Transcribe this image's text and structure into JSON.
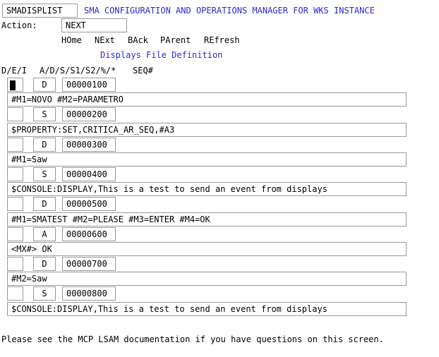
{
  "header": {
    "screen_name": "SMADISPLIST",
    "title": "SMA CONFIGURATION AND OPERATIONS MANAGER FOR WKS INSTANCE"
  },
  "action": {
    "label": "Action:",
    "value": "NEXT"
  },
  "nav": {
    "home": "HOme",
    "next": "NExt",
    "back": "BAck",
    "parent": "PArent",
    "refresh": "REfresh"
  },
  "subtitle": "Displays File Definition",
  "columns": {
    "dei": "D/E/I",
    "type": "A/D/S/S1/S2/%/*",
    "seq": "SEQ#"
  },
  "rows": [
    {
      "dei": "",
      "type": "D",
      "seq": "00000100",
      "text": "#M1=NOVO #M2=PARAMETRO"
    },
    {
      "dei": "",
      "type": "S",
      "seq": "00000200",
      "text": "$PROPERTY:SET,CRITICA_AR_SEQ,#A3"
    },
    {
      "dei": "",
      "type": "D",
      "seq": "00000300",
      "text": "#M1=Saw"
    },
    {
      "dei": "",
      "type": "S",
      "seq": "00000400",
      "text": "$CONSOLE:DISPLAY,This is a test to send an event from displays"
    },
    {
      "dei": "",
      "type": "D",
      "seq": "00000500",
      "text": "#M1=SMATEST #M2=PLEASE #M3=ENTER #M4=OK"
    },
    {
      "dei": "",
      "type": "A",
      "seq": "00000600",
      "text": "<MX#> OK"
    },
    {
      "dei": "",
      "type": "D",
      "seq": "00000700",
      "text": "#M2=Saw"
    },
    {
      "dei": "",
      "type": "S",
      "seq": "00000800",
      "text": "$CONSOLE:DISPLAY,This is a test to send an event from displays"
    }
  ],
  "footer": "Please see the MCP LSAM documentation if you have questions on this screen."
}
